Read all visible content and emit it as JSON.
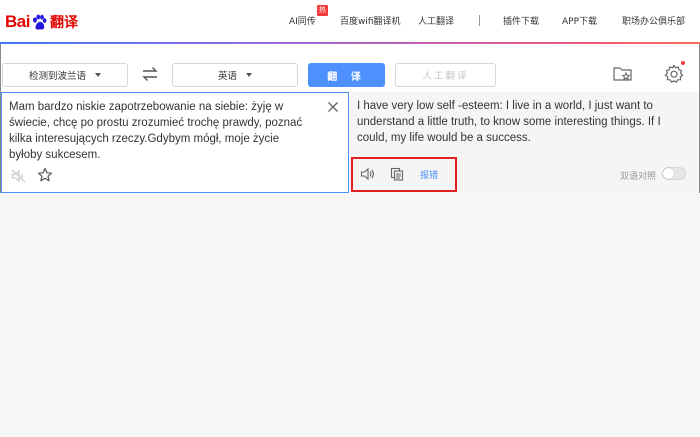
{
  "header": {
    "logo": {
      "bai": "Bai",
      "du": "du",
      "fanyi": "翻译"
    },
    "nav": [
      {
        "label": "AI同传"
      },
      {
        "label": "百度wifi翻译机"
      },
      {
        "label": "人工翻译"
      },
      {
        "label": "插件下载"
      },
      {
        "label": "APP下载"
      },
      {
        "label": "职场办公俱乐部"
      }
    ],
    "hot_badge": "热",
    "gradient_colors": [
      "#3f7bf5",
      "#8f6be0",
      "#c05fb5",
      "#ef5a78",
      "#f66d5a"
    ]
  },
  "toolbar": {
    "source_lang": "检测到波兰语",
    "target_lang": "英语",
    "translate_label": "翻 译",
    "human_translate_label": "人工翻译",
    "accent_color": "#4d90fe"
  },
  "source": {
    "text": "Mam bardzo niskie zapotrzebowanie na siebie: żyję w świecie, chcę po prostu zrozumieć trochę prawdy, poznać kilka interesujących rzeczy.Gdybym mógł, moje życie byłoby sukcesem."
  },
  "target": {
    "text": "I have very low self -esteem: I live in a world, I just want to understand a little truth, to know some interesting things. If I could, my life would be a success.",
    "report_label": "报错",
    "bilingual_label": "双语对照",
    "bilingual_enabled": false
  },
  "icons": [
    "swap-icon",
    "folder-star-icon",
    "settings-gear-icon",
    "close-icon",
    "speaker-muted-icon",
    "star-icon",
    "speaker-icon",
    "copy-icon"
  ]
}
